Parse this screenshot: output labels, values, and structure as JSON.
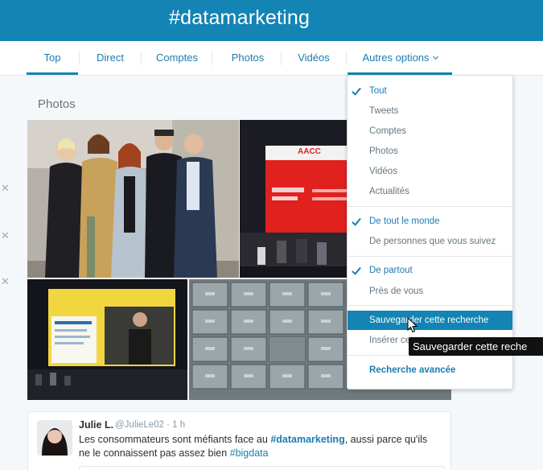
{
  "header": {
    "title": "#datamarketing"
  },
  "nav": {
    "tabs": [
      {
        "label": "Top"
      },
      {
        "label": "Direct"
      },
      {
        "label": "Comptes"
      },
      {
        "label": "Photos"
      },
      {
        "label": "Vidéos"
      },
      {
        "label": "Autres options"
      }
    ]
  },
  "photos": {
    "title": "Photos"
  },
  "tweet": {
    "name": "Julie L.",
    "meta": "@JulieLe02 · 1 h",
    "text_before": "Les consommateurs sont méfiants face au ",
    "hashtag1": "#datamarketing",
    "text_middle": ", aussi parce qu'ils ne le connaissent pas assez bien ",
    "hashtag2": "#bigdata"
  },
  "dropdown": {
    "group1": [
      "Tout",
      "Tweets",
      "Comptes",
      "Photos",
      "Vidéos",
      "Actualités"
    ],
    "group2": [
      "De tout le monde",
      "De personnes que vous suivez"
    ],
    "group3": [
      "De partout",
      "Près de vous"
    ],
    "group4": [
      "Sauvegarder cette recherche",
      "Insérer ce"
    ],
    "advanced": "Recherche avancée"
  },
  "tooltip": {
    "text": "Sauvegarder cette reche"
  },
  "slide": {
    "brand": "AACC"
  },
  "colors": {
    "brand": "#1384b4",
    "link": "#1b7cb0",
    "hover": "#1384b4"
  }
}
